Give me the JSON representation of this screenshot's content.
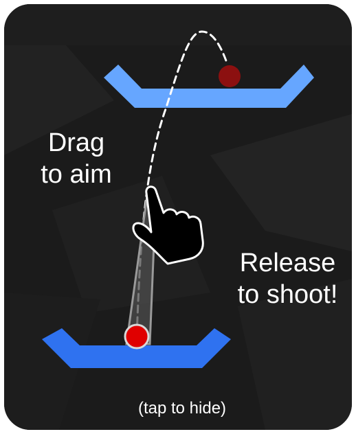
{
  "tutorial": {
    "drag_line1": "Drag",
    "drag_line2": "to aim",
    "release_line1": "Release",
    "release_line2": "to shoot!",
    "dismiss_hint": "(tap to hide)"
  },
  "icons": {
    "hand": "pointing-hand-icon"
  },
  "colors": {
    "background": "#1b1b1b",
    "border": "#ffffff",
    "target_platform": "#66a6ff",
    "launch_platform": "#2f72f0",
    "ball_active": "#e00000",
    "ball_target": "#8c1010",
    "trajectory": "#ffffff"
  }
}
